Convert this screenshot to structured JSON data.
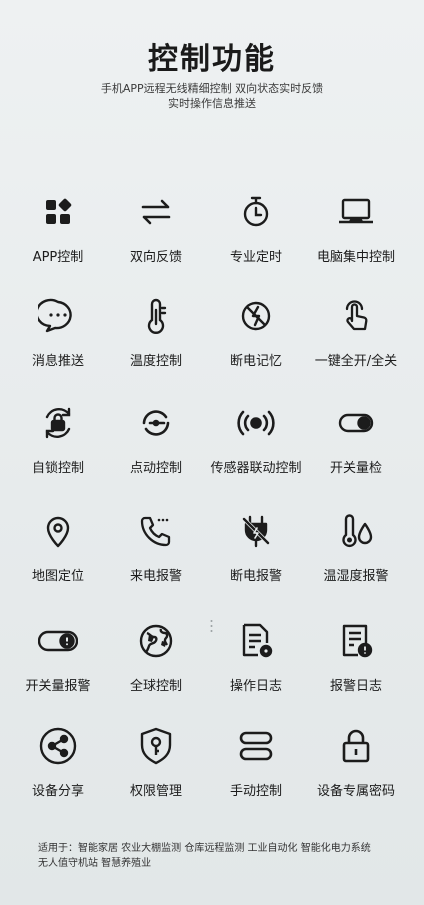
{
  "header": {
    "title": "控制功能",
    "subtitle_line1": "手机APP远程无线精细控制  双向状态实时反馈",
    "subtitle_line2": "实时操作信息推送"
  },
  "features": [
    {
      "label": "APP控制",
      "icon": "app-grid-icon"
    },
    {
      "label": "双向反馈",
      "icon": "bidirectional-arrows-icon"
    },
    {
      "label": "专业定时",
      "icon": "timer-icon"
    },
    {
      "label": "电脑集中控制",
      "icon": "laptop-icon"
    },
    {
      "label": "消息推送",
      "icon": "message-bubble-icon"
    },
    {
      "label": "温度控制",
      "icon": "thermometer-icon"
    },
    {
      "label": "断电记忆",
      "icon": "power-off-memory-icon"
    },
    {
      "label": "一键全开/全关",
      "icon": "tap-finger-icon"
    },
    {
      "label": "自锁控制",
      "icon": "self-lock-icon"
    },
    {
      "label": "点动控制",
      "icon": "jog-control-icon"
    },
    {
      "label": "传感器联动控制",
      "icon": "sensor-signal-icon"
    },
    {
      "label": "开关量检",
      "icon": "toggle-switch-icon"
    },
    {
      "label": "地图定位",
      "icon": "location-pin-icon"
    },
    {
      "label": "来电报警",
      "icon": "incoming-call-icon"
    },
    {
      "label": "断电报警",
      "icon": "power-plug-alarm-icon"
    },
    {
      "label": "温湿度报警",
      "icon": "temp-humidity-icon"
    },
    {
      "label": "开关量报警",
      "icon": "switch-alarm-icon"
    },
    {
      "label": "全球控制",
      "icon": "globe-icon"
    },
    {
      "label": "操作日志",
      "icon": "operation-log-icon"
    },
    {
      "label": "报警日志",
      "icon": "alarm-log-icon"
    },
    {
      "label": "设备分享",
      "icon": "share-icon"
    },
    {
      "label": "权限管理",
      "icon": "permission-shield-icon"
    },
    {
      "label": "手动控制",
      "icon": "manual-control-icon"
    },
    {
      "label": "设备专属密码",
      "icon": "padlock-icon"
    }
  ],
  "footer": {
    "line1": "适用于：智能家居  农业大棚监测  仓库远程监测  工业自动化  智能化电力系统",
    "line2": "无人值守机站  智慧养殖业"
  }
}
